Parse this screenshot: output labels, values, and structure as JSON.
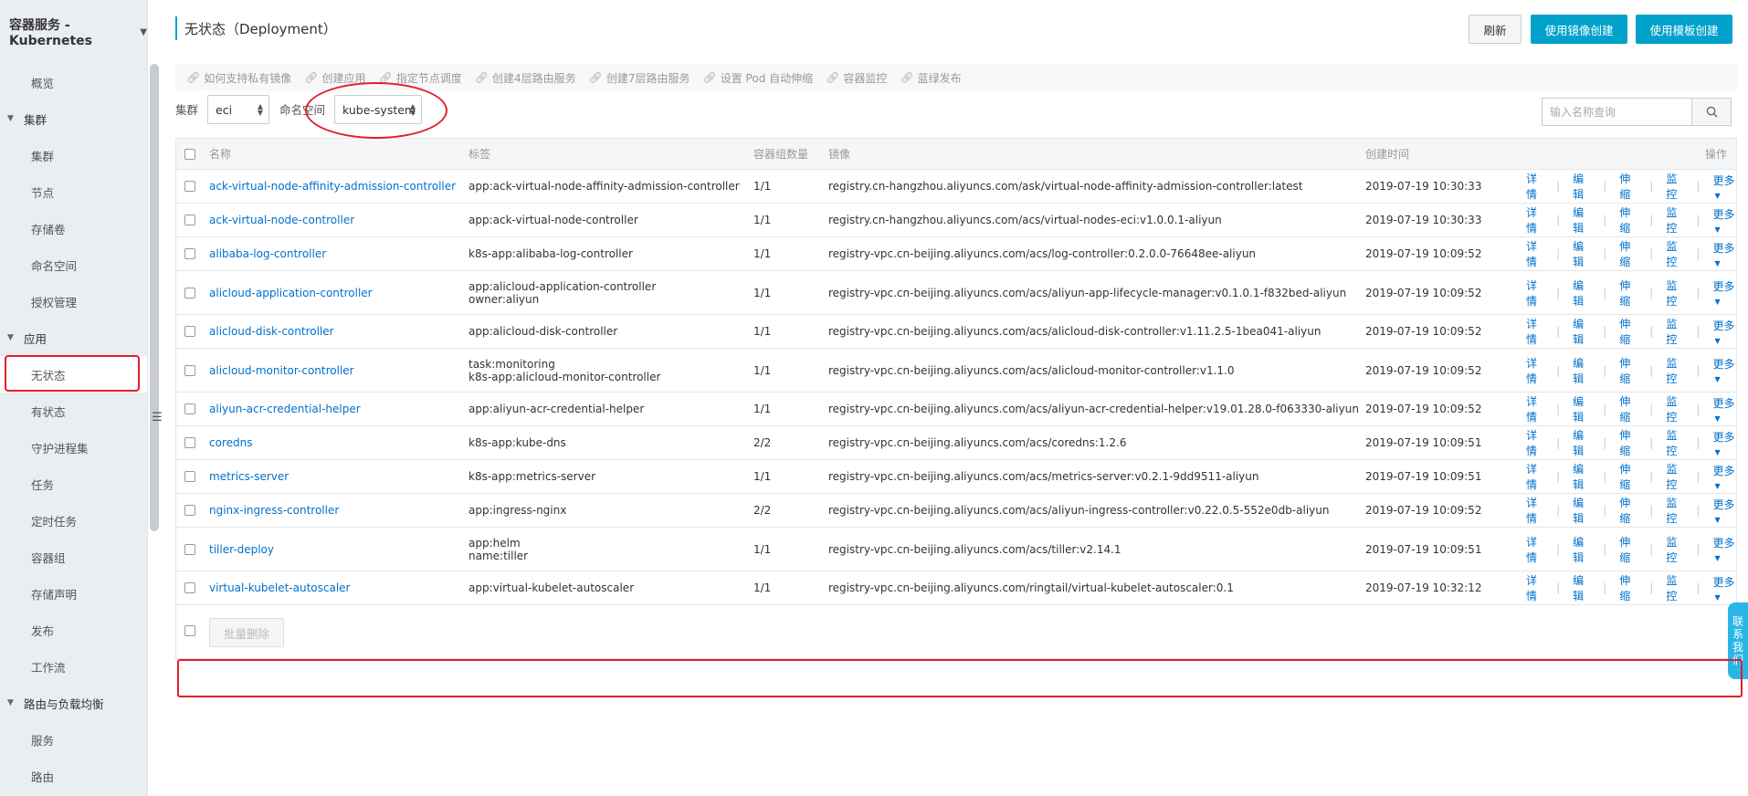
{
  "sidebar": {
    "header": "容器服务 - Kubernetes",
    "overview": "概览",
    "groups": [
      {
        "label": "集群",
        "items": [
          "集群",
          "节点",
          "存储卷",
          "命名空间",
          "授权管理"
        ]
      },
      {
        "label": "应用",
        "items": [
          "无状态",
          "有状态",
          "守护进程集",
          "任务",
          "定时任务",
          "容器组",
          "存储声明",
          "发布",
          "工作流"
        ]
      },
      {
        "label": "路由与负载均衡",
        "items": [
          "服务",
          "路由"
        ]
      }
    ],
    "active_item": "无状态"
  },
  "page": {
    "title": "无状态（Deployment）",
    "refresh_label": "刷新",
    "create_image_label": "使用镜像创建",
    "create_template_label": "使用模板创建"
  },
  "help_links": [
    "如何支持私有镜像",
    "创建应用",
    "指定节点调度",
    "创建4层路由服务",
    "创建7层路由服务",
    "设置 Pod 自动伸缩",
    "容器监控",
    "蓝绿发布"
  ],
  "filters": {
    "cluster_label": "集群",
    "cluster_value": "eci",
    "namespace_label": "命名空间",
    "namespace_value": "kube-system",
    "search_placeholder": "输入名称查询"
  },
  "table": {
    "headers": {
      "name": "名称",
      "labels": "标签",
      "pods": "容器组数量",
      "image": "镜像",
      "created": "创建时间",
      "actions": "操作"
    },
    "actions": [
      "详情",
      "编辑",
      "伸缩",
      "监控",
      "更多"
    ],
    "rows": [
      {
        "name": "ack-virtual-node-affinity-admission-controller",
        "labels": [
          "app:ack-virtual-node-affinity-admission-controller"
        ],
        "pods": "1/1",
        "image": "registry.cn-hangzhou.aliyuncs.com/ask/virtual-node-affinity-admission-controller:latest",
        "created": "2019-07-19 10:30:33"
      },
      {
        "name": "ack-virtual-node-controller",
        "labels": [
          "app:ack-virtual-node-controller"
        ],
        "pods": "1/1",
        "image": "registry.cn-hangzhou.aliyuncs.com/acs/virtual-nodes-eci:v1.0.0.1-aliyun",
        "created": "2019-07-19 10:30:33"
      },
      {
        "name": "alibaba-log-controller",
        "labels": [
          "k8s-app:alibaba-log-controller"
        ],
        "pods": "1/1",
        "image": "registry-vpc.cn-beijing.aliyuncs.com/acs/log-controller:0.2.0.0-76648ee-aliyun",
        "created": "2019-07-19 10:09:52"
      },
      {
        "name": "alicloud-application-controller",
        "labels": [
          "app:alicloud-application-controller",
          "owner:aliyun"
        ],
        "pods": "1/1",
        "image": "registry-vpc.cn-beijing.aliyuncs.com/acs/aliyun-app-lifecycle-manager:v0.1.0.1-f832bed-aliyun",
        "created": "2019-07-19 10:09:52"
      },
      {
        "name": "alicloud-disk-controller",
        "labels": [
          "app:alicloud-disk-controller"
        ],
        "pods": "1/1",
        "image": "registry-vpc.cn-beijing.aliyuncs.com/acs/alicloud-disk-controller:v1.11.2.5-1bea041-aliyun",
        "created": "2019-07-19 10:09:52"
      },
      {
        "name": "alicloud-monitor-controller",
        "labels": [
          "task:monitoring",
          "k8s-app:alicloud-monitor-controller"
        ],
        "pods": "1/1",
        "image": "registry-vpc.cn-beijing.aliyuncs.com/acs/alicloud-monitor-controller:v1.1.0",
        "created": "2019-07-19 10:09:52"
      },
      {
        "name": "aliyun-acr-credential-helper",
        "labels": [
          "app:aliyun-acr-credential-helper"
        ],
        "pods": "1/1",
        "image": "registry-vpc.cn-beijing.aliyuncs.com/acs/aliyun-acr-credential-helper:v19.01.28.0-f063330-aliyun",
        "created": "2019-07-19 10:09:52"
      },
      {
        "name": "coredns",
        "labels": [
          "k8s-app:kube-dns"
        ],
        "pods": "2/2",
        "image": "registry-vpc.cn-beijing.aliyuncs.com/acs/coredns:1.2.6",
        "created": "2019-07-19 10:09:51"
      },
      {
        "name": "metrics-server",
        "labels": [
          "k8s-app:metrics-server"
        ],
        "pods": "1/1",
        "image": "registry-vpc.cn-beijing.aliyuncs.com/acs/metrics-server:v0.2.1-9dd9511-aliyun",
        "created": "2019-07-19 10:09:51"
      },
      {
        "name": "nginx-ingress-controller",
        "labels": [
          "app:ingress-nginx"
        ],
        "pods": "2/2",
        "image": "registry-vpc.cn-beijing.aliyuncs.com/acs/aliyun-ingress-controller:v0.22.0.5-552e0db-aliyun",
        "created": "2019-07-19 10:09:52"
      },
      {
        "name": "tiller-deploy",
        "labels": [
          "app:helm",
          "name:tiller"
        ],
        "pods": "1/1",
        "image": "registry-vpc.cn-beijing.aliyuncs.com/acs/tiller:v2.14.1",
        "created": "2019-07-19 10:09:51"
      },
      {
        "name": "virtual-kubelet-autoscaler",
        "labels": [
          "app:virtual-kubelet-autoscaler"
        ],
        "pods": "1/1",
        "image": "registry-vpc.cn-beijing.aliyuncs.com/ringtail/virtual-kubelet-autoscaler:0.1",
        "created": "2019-07-19 10:32:12"
      }
    ],
    "batch_delete_label": "批量删除"
  },
  "contact_tab": "联系我们",
  "colors": {
    "accent": "#00a2ca",
    "link": "#0070cc",
    "annotation": "#e0202b",
    "sidebar_bg": "#eaedf1"
  }
}
